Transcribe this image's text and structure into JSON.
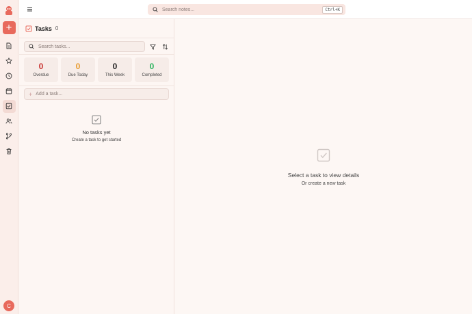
{
  "header": {
    "search_placeholder": "Search notes...",
    "search_shortcut": "Ctrl+K"
  },
  "sidebar": {
    "new_label": "+",
    "items": [
      {
        "icon": "file-icon"
      },
      {
        "icon": "star-icon"
      },
      {
        "icon": "clock-icon"
      },
      {
        "icon": "calendar-icon"
      },
      {
        "icon": "tasks-icon",
        "active": true
      },
      {
        "icon": "users-icon"
      },
      {
        "icon": "branch-icon"
      },
      {
        "icon": "trash-icon"
      }
    ],
    "avatar_initial": "C"
  },
  "tasks": {
    "title": "Tasks",
    "count": "0",
    "search_placeholder": "Search tasks...",
    "stats": [
      {
        "value": "0",
        "label": "Overdue",
        "color": "#c8322f"
      },
      {
        "value": "0",
        "label": "Due Today",
        "color": "#e89a2c"
      },
      {
        "value": "0",
        "label": "This Week",
        "color": "#222222"
      },
      {
        "value": "0",
        "label": "Completed",
        "color": "#2bb35e"
      }
    ],
    "add_placeholder": "Add a task...",
    "empty_title": "No tasks yet",
    "empty_subtitle": "Create a task to get started"
  },
  "detail": {
    "empty_title": "Select a task to view details",
    "empty_subtitle": "Or create a new task"
  },
  "colors": {
    "accent": "#e8695c",
    "sidebar_bg": "#fbeeea",
    "page_bg": "#fdf6f3"
  }
}
